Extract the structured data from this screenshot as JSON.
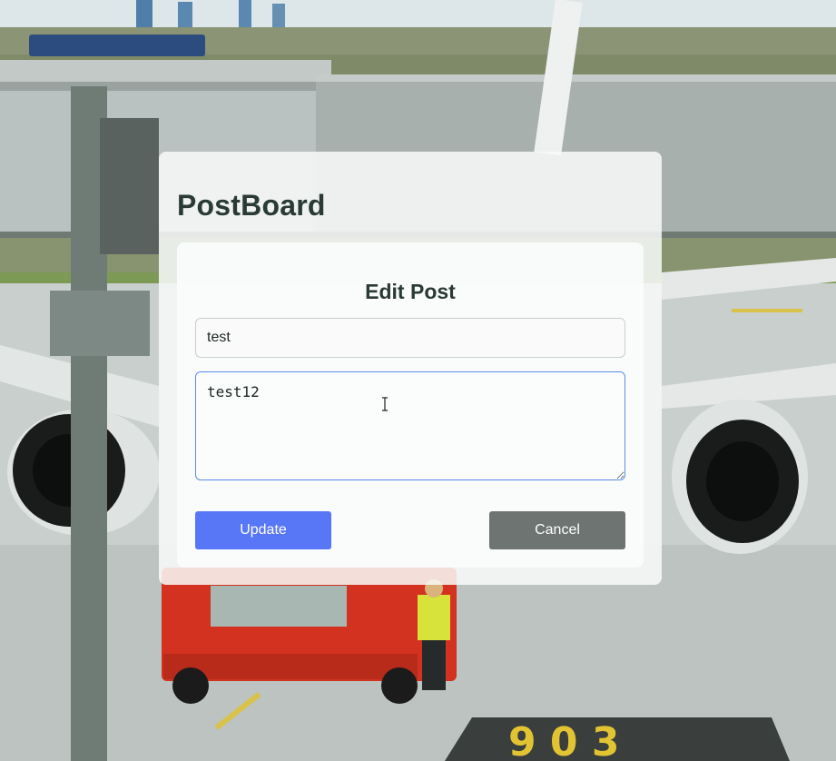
{
  "app": {
    "brand": "PostBoard"
  },
  "edit_form": {
    "heading": "Edit Post",
    "title_value": "test",
    "content_value": "test12",
    "update_label": "Update",
    "cancel_label": "Cancel"
  },
  "colors": {
    "update_button": "#5877f6",
    "cancel_button": "#6d7472",
    "focused_border": "#5b8ee8",
    "heading_text": "#2a3a34"
  },
  "icons": {
    "text_cursor": "i-beam-cursor-icon"
  }
}
